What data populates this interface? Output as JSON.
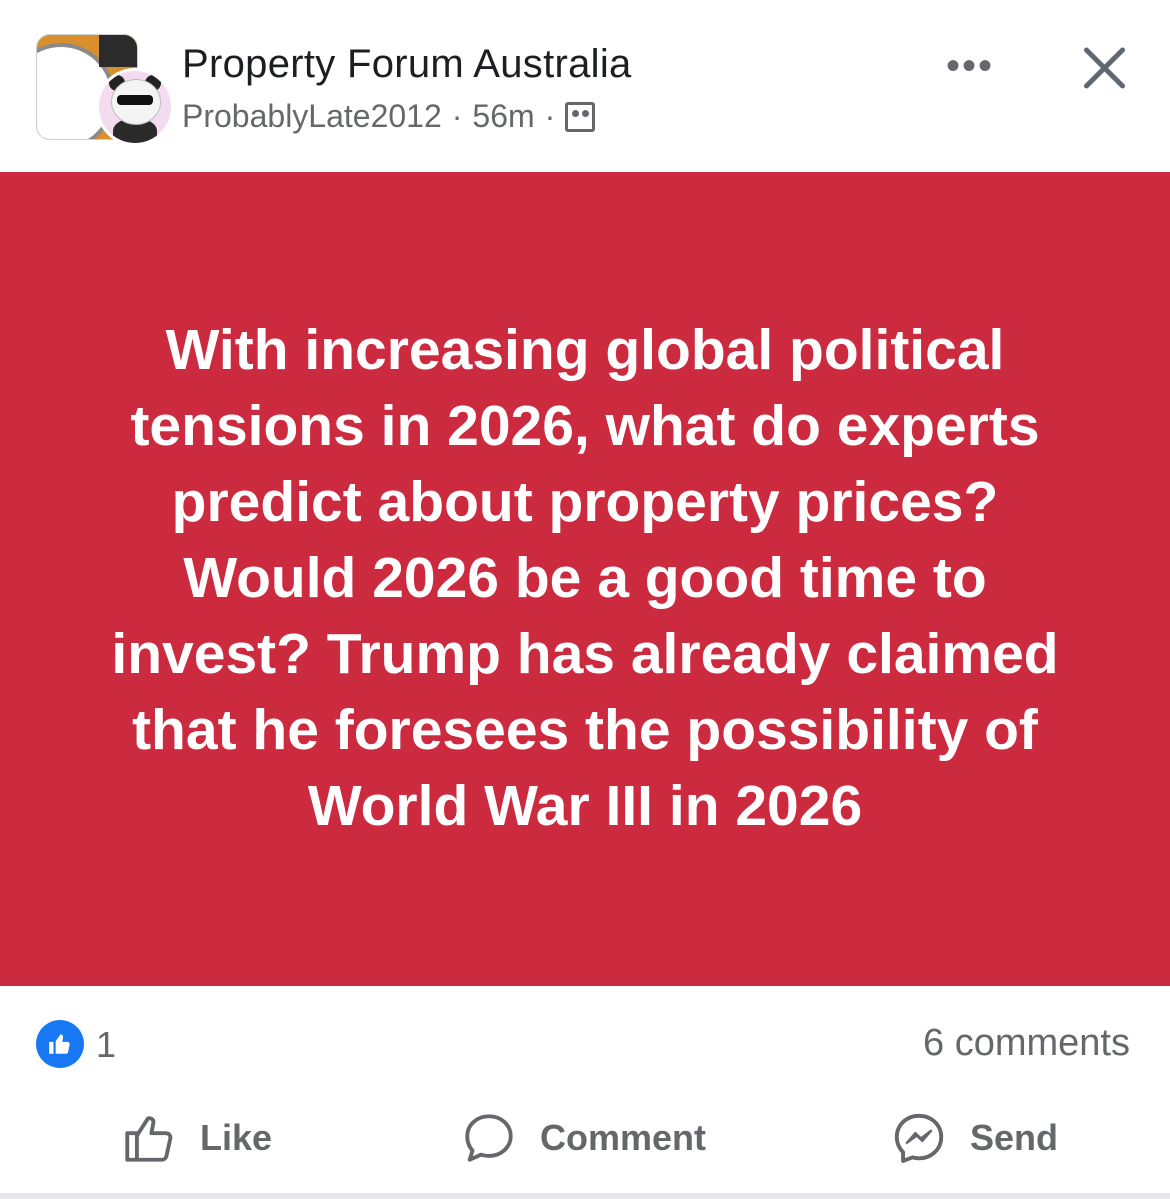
{
  "header": {
    "group_name": "Property Forum Australia",
    "author": "ProbablyLate2012",
    "separator": "·",
    "time": "56m",
    "audience_icon": "group-members-icon",
    "more_label": "•••",
    "close_icon": "close-icon"
  },
  "post": {
    "background_color": "#cc2a3f",
    "text": "With increasing global political tensions in 2026, what do experts predict about property prices? Would 2026 be a good time to invest? Trump has already claimed that he foresees the possibility of World War III in 2026"
  },
  "reactions": {
    "icon": "thumbs-up-reaction-icon",
    "count": "1",
    "comments": "6 comments"
  },
  "actions": {
    "like": "Like",
    "comment": "Comment",
    "send": "Send"
  }
}
